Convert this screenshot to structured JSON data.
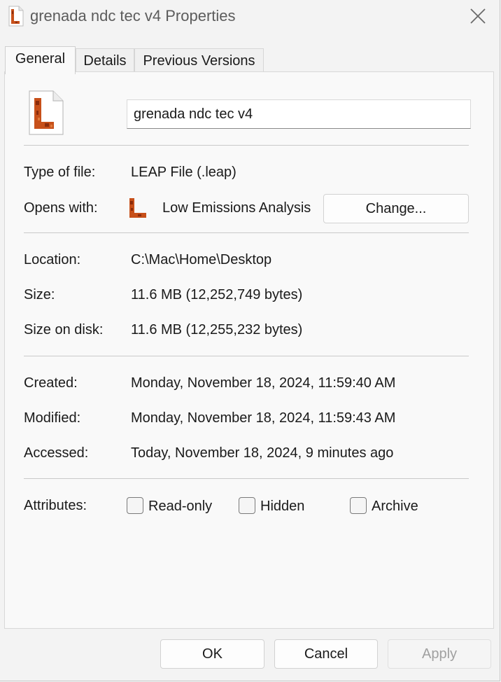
{
  "window": {
    "title": "grenada ndc tec v4 Properties",
    "close_icon": "close-icon"
  },
  "tabs": [
    {
      "label": "General",
      "active": true
    },
    {
      "label": "Details",
      "active": false
    },
    {
      "label": "Previous Versions",
      "active": false
    }
  ],
  "general": {
    "file_icon": "leap-file-icon",
    "file_name": "grenada ndc tec v4",
    "type_of_file": {
      "label": "Type of file:",
      "value": "LEAP File (.leap)"
    },
    "opens_with": {
      "label": "Opens with:",
      "value": "Low Emissions Analysis",
      "app_icon": "leap-app-icon",
      "change_label": "Change..."
    },
    "location": {
      "label": "Location:",
      "value": "C:\\Mac\\Home\\Desktop"
    },
    "size": {
      "label": "Size:",
      "value": "11.6 MB (12,252,749 bytes)"
    },
    "size_on_disk": {
      "label": "Size on disk:",
      "value": "11.6 MB (12,255,232 bytes)"
    },
    "created": {
      "label": "Created:",
      "value": "Monday, November 18, 2024, 11:59:40 AM"
    },
    "modified": {
      "label": "Modified:",
      "value": "Monday, November 18, 2024, 11:59:43 AM"
    },
    "accessed": {
      "label": "Accessed:",
      "value": "Today, November 18, 2024, 9 minutes ago"
    },
    "attributes": {
      "label": "Attributes:",
      "read_only": {
        "label": "Read-only",
        "checked": false
      },
      "hidden": {
        "label": "Hidden",
        "checked": false
      },
      "archive": {
        "label": "Archive",
        "checked": false
      }
    }
  },
  "footer": {
    "ok": "OK",
    "cancel": "Cancel",
    "apply": "Apply",
    "apply_enabled": false
  },
  "colors": {
    "window_bg": "#f3f3f3",
    "panel_bg": "#f9f9f9",
    "leap_icon_orange": "#c7501a",
    "leap_icon_dark": "#8a2c0c"
  }
}
